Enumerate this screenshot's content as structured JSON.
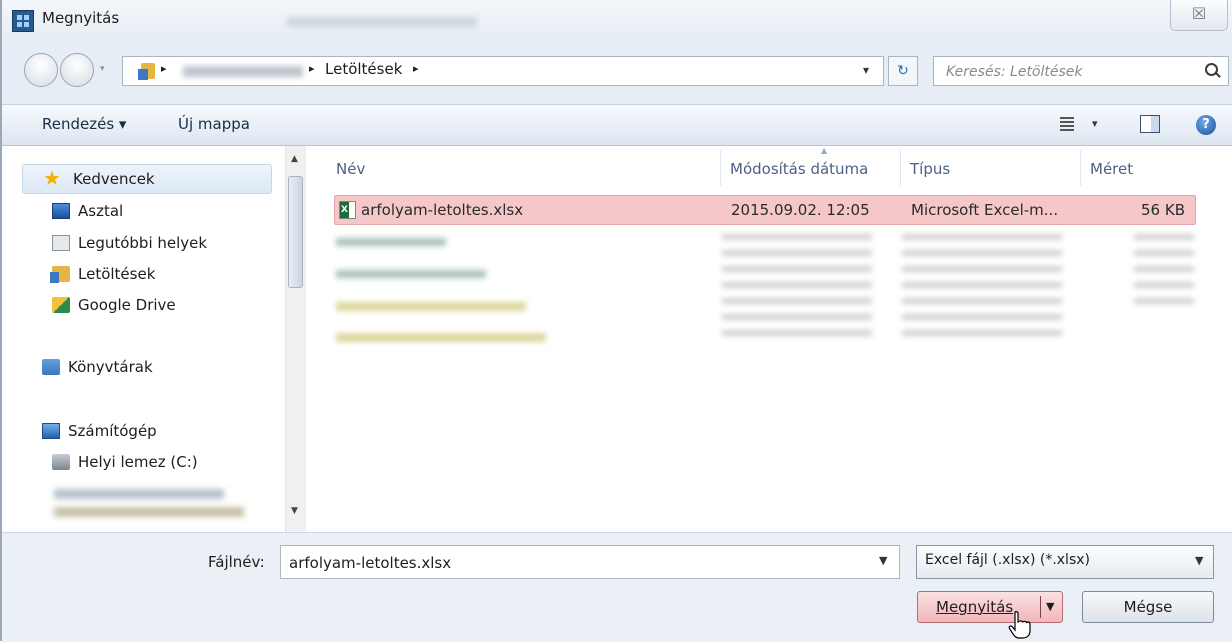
{
  "window": {
    "title": "Megnyitás",
    "close_symbol": "☒"
  },
  "address": {
    "separator": "▸",
    "current": "Letöltések",
    "dropdown_symbol": "▾",
    "refresh_symbol": "↻",
    "search_placeholder": "Keresés: Letöltések"
  },
  "toolbar": {
    "organize": "Rendezés ▾",
    "new_folder": "Új mappa",
    "views_dropdown": "▾",
    "help": "?"
  },
  "navigation": {
    "favorites": "Kedvencek",
    "items": [
      "Asztal",
      "Legutóbbi helyek",
      "Letöltések",
      "Google Drive"
    ],
    "libraries": "Könyvtárak",
    "computer": "Számítógép",
    "drive": "Helyi lemez (C:)"
  },
  "columns": {
    "name": "Név",
    "date": "Módosítás dátuma",
    "type": "Típus",
    "size": "Méret"
  },
  "files": [
    {
      "name": "arfolyam-letoltes.xlsx",
      "date": "2015.09.02. 12:05",
      "type": "Microsoft Excel-m...",
      "size": "56 KB"
    }
  ],
  "bottom": {
    "filename_label": "Fájlnév:",
    "filename_value": "arfolyam-letoltes.xlsx",
    "filetype": "Excel fájl (.xlsx) (*.xlsx)",
    "open_button": "Megnyitás",
    "cancel_button": "Mégse"
  },
  "colors": {
    "selection": "#f5c7c9",
    "accent": "#2d6fb5"
  }
}
